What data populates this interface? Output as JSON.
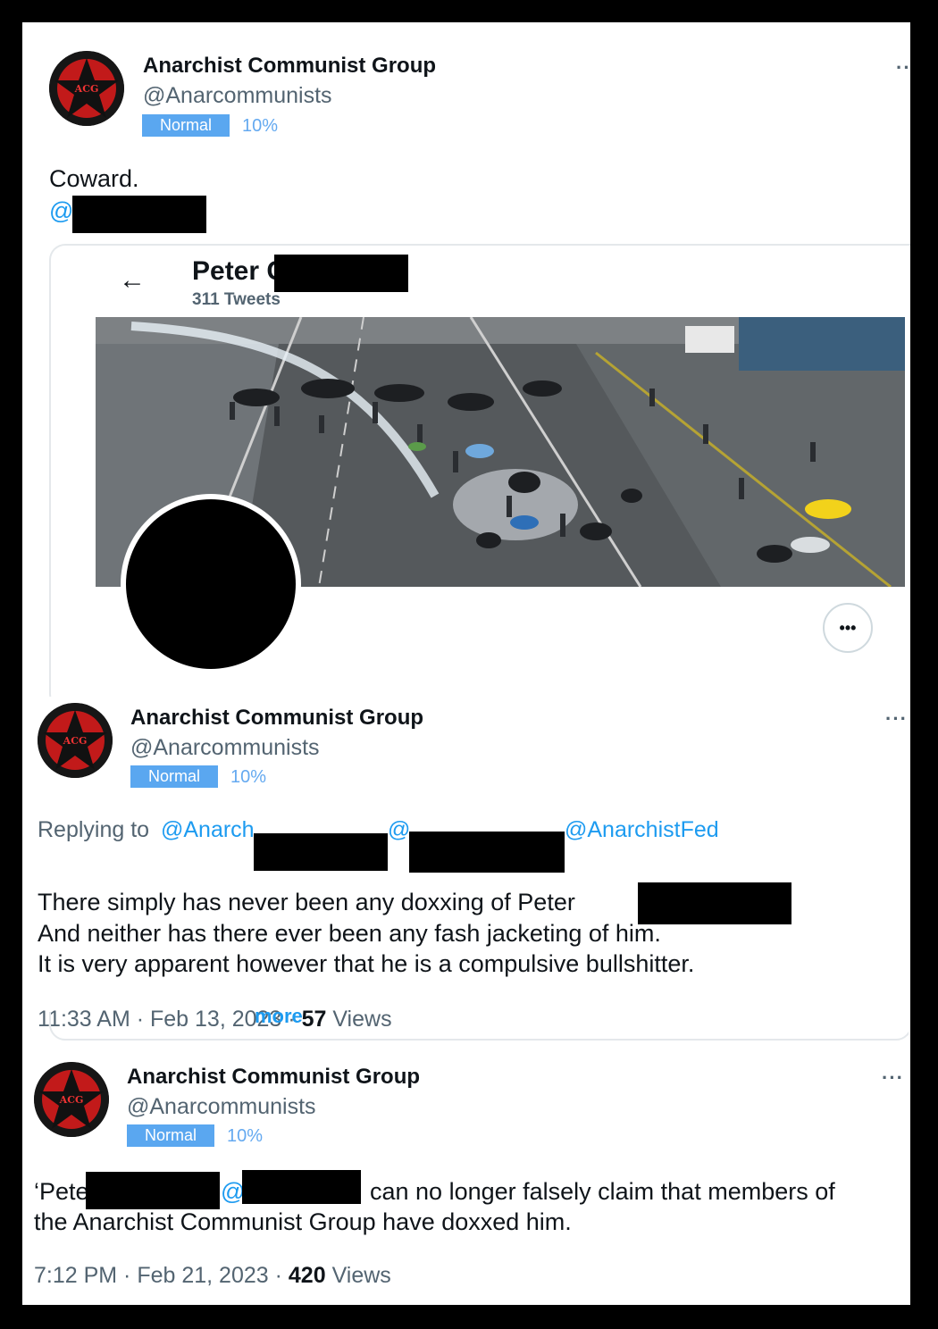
{
  "tweets": [
    {
      "name": "Anarchist Communist Group",
      "handle": "@Anarcommunists",
      "badge": "Normal",
      "percent": "10%",
      "text": "Coward.",
      "mention": "@",
      "more": "···"
    },
    {
      "name": "Anarchist Communist Group",
      "handle": "@Anarcommunists",
      "badge": "Normal",
      "percent": "10%",
      "replying_prefix": "Replying to",
      "reply_mention_1": "@Anarch",
      "reply_mention_2": "@",
      "reply_mention_3": "@AnarchistFed",
      "line1": "There simply has never been any doxxing of Peter",
      "line2": "And neither has there ever been any fash jacketing of him.",
      "line3": "It is very apparent however that he is a compulsive bullshitter.",
      "time": "11:33 AM · Feb 13, 2023 ·",
      "views_count": "57",
      "views_label": "Views",
      "more": "···"
    },
    {
      "name": "Anarchist Communist Group",
      "handle": "@Anarcommunists",
      "badge": "Normal",
      "percent": "10%",
      "text_start": "‘Pete",
      "text_mention": "@",
      "text_rest": "can no longer falsely claim that members of",
      "line2": "the Anarchist Communist Group have doxxed him.",
      "time": "7:12 PM · Feb 21, 2023 ·",
      "views_count": "420",
      "views_label": "Views",
      "more": "···"
    }
  ],
  "embedded_profile": {
    "back_arrow": "←",
    "name": "Peter",
    "name_cut": "C",
    "tweet_count": "311 Tweets",
    "overflow": "•••",
    "cut_text": "more"
  },
  "avatar_logo_text": "ACG",
  "colors": {
    "link": "#1d9bf0",
    "badge": "#5aa7f0",
    "muted": "#536471"
  }
}
